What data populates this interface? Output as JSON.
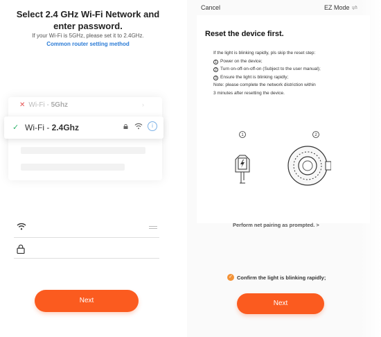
{
  "left": {
    "title": "Select 2.4 GHz Wi-Fi Network and enter password.",
    "subtitle": "If your Wi-Fi is 5GHz, please set it to 2.4GHz.",
    "router_link": "Common router setting method",
    "networks": [
      {
        "name": "Wi-Fi - ",
        "band": "5Ghz",
        "status": "unsupported"
      },
      {
        "name": "Wi-Fi - ",
        "band": "2.4Ghz",
        "status": "selected"
      }
    ],
    "next_label": "Next"
  },
  "right": {
    "cancel_label": "Cancel",
    "mode_label": "EZ Mode",
    "title": "Reset the device first.",
    "intro": "If the light is blinking rapidly, pls skip the reset step:",
    "steps": [
      "Power on the device;",
      "Turn on-off-on-off-on (Subject to the user manual);",
      "Ensure the light is blinking rapidly;"
    ],
    "step_markers": [
      "1",
      "2",
      "3"
    ],
    "note_line1": "Note: please complete the network distriction within",
    "note_line2": "3 minutes after resetting the device.",
    "illustration_markers": [
      "1",
      "2"
    ],
    "prompt_link": "Perform net pairing as prompted. >",
    "confirm_label": "Confirm the light is blinking rapidly;",
    "next_label": "Next"
  },
  "colors": {
    "accent": "#fb5b1f",
    "link": "#2a7bd6",
    "check_green": "#2fb36b",
    "error_red": "#e55353",
    "confirm_orange": "#f39236"
  }
}
